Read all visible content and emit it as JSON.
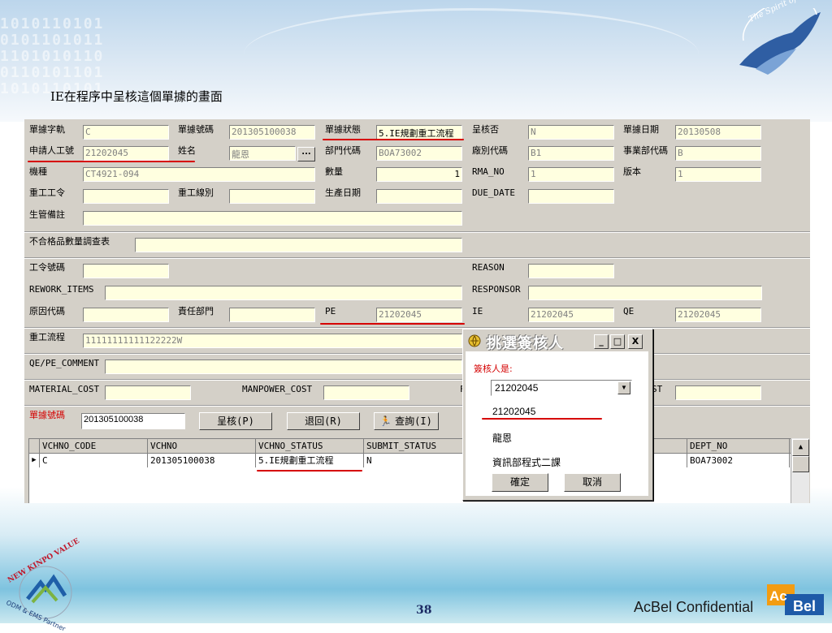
{
  "slide": {
    "caption": "IE在程序中呈核這個單據的畫面",
    "brand_tagline": "The Spirit of The Eagle",
    "page_number": "38",
    "confidential": "AcBel Confidential",
    "acbel_logo": "AcBel",
    "kinpo_badge_top": "NEW KINPO VALUE",
    "kinpo_badge_bottom": "ODM & EMS Partner"
  },
  "form": {
    "row1": {
      "doc_type_label": "單據字軌",
      "doc_type_value": "C",
      "doc_no_label": "單據號碼",
      "doc_no_value": "201305100038",
      "doc_status_label": "單據狀態",
      "doc_status_value": "5.IE規劃重工流程",
      "approved_label": "呈核否",
      "approved_value": "N",
      "doc_date_label": "單據日期",
      "doc_date_value": "20130508"
    },
    "row2": {
      "applicant_id_label": "申請人工號",
      "applicant_id_value": "21202045",
      "name_label": "姓名",
      "name_value": "龍恩",
      "lookup_button": "...",
      "dept_code_label": "部門代碼",
      "dept_code_value": "BOA73002",
      "factory_code_label": "廠別代碼",
      "factory_code_value": "B1",
      "bu_code_label": "事業部代碼",
      "bu_code_value": "B"
    },
    "row3": {
      "model_label": "機種",
      "model_value": "CT4921-094",
      "qty_label": "數量",
      "qty_value": "1",
      "rma_label": "RMA_NO",
      "rma_value": "1",
      "version_label": "版本",
      "version_value": "1"
    },
    "row4": {
      "rework_order_label": "重工工令",
      "rework_order_value": "",
      "rework_line_label": "重工線別",
      "rework_line_value": "",
      "prod_date_label": "生產日期",
      "prod_date_value": "",
      "due_date_label": "DUE_DATE",
      "due_date_value": ""
    },
    "row5": {
      "pc_note_label": "生管備註",
      "pc_note_value": ""
    },
    "row6": {
      "ng_survey_label": "不合格品數量調查表",
      "ng_survey_value": ""
    },
    "row7": {
      "work_order_label": "工令號碼",
      "work_order_value": "",
      "reason_label": "REASON",
      "reason_value": ""
    },
    "row8": {
      "rework_items_label": "REWORK_ITEMS",
      "rework_items_value": "",
      "responsor_label": "RESPONSOR",
      "responsor_value": ""
    },
    "row9": {
      "cause_code_label": "原因代碼",
      "cause_code_value": "",
      "resp_dept_label": "責任部門",
      "resp_dept_value": "",
      "pe_label": "PE",
      "pe_value": "21202045",
      "ie_label": "IE",
      "ie_value": "21202045",
      "qe_label": "QE",
      "qe_value": "21202045"
    },
    "row10": {
      "rework_flow_label": "重工流程",
      "rework_flow_value": "11111111111122222W"
    },
    "row11": {
      "qe_pe_comment_label": "QE/PE_COMMENT",
      "qe_pe_comment_value": ""
    },
    "row12": {
      "material_cost_label": "MATERIAL_COST",
      "material_cost_value": "",
      "manpower_cost_label": "MANPOWER_COST",
      "manpower_cost_value": "",
      "hidden_cost_label_start": "F",
      "hidden_cost_label_end": "ST",
      "hidden_cost_value": ""
    },
    "row13": {
      "doc_no_label": "單據號碼",
      "doc_no_value": "201305100038",
      "submit_button": "呈核(P)",
      "return_button": "退回(R)",
      "query_button": "查詢(I)"
    }
  },
  "grid": {
    "columns": [
      "VCHNO_CODE",
      "VCHNO",
      "VCHNO_STATUS",
      "SUBMIT_STATUS",
      "",
      "DEPT_NO"
    ],
    "rows": [
      [
        "C",
        "201305100038",
        "5.IE規劃重工流程",
        "N",
        "",
        "BOA73002"
      ]
    ]
  },
  "dialog": {
    "title": "挑選簽核人",
    "minimize": "_",
    "maximize": "□",
    "close": "X",
    "approver_label": "簽核人是:",
    "approver_selected": "21202045",
    "options": [
      "21202045",
      "龍恩",
      "資訊部程式二課"
    ],
    "ok_button": "確定",
    "cancel_button": "取消"
  },
  "colors": {
    "annotation_red": "#d60000",
    "field_yellow": "#ffffe0",
    "panel_gray": "#d4d0c8"
  }
}
